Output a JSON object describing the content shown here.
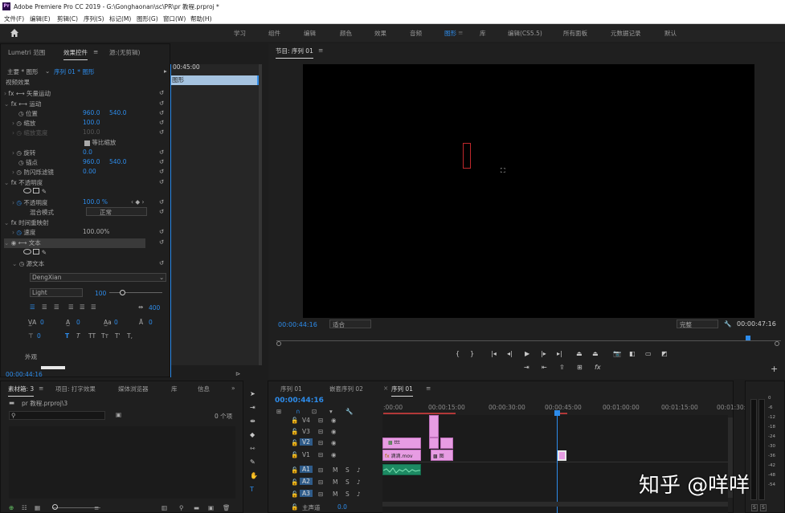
{
  "app": {
    "title": "Adobe Premiere Pro CC 2019 - G:\\Gonghaonan\\sc\\PR\\pr 教程.prproj *"
  },
  "menu": [
    "文件(F)",
    "编辑(E)",
    "剪辑(C)",
    "序列(S)",
    "标记(M)",
    "图形(G)",
    "窗口(W)",
    "帮助(H)"
  ],
  "workspaces": [
    "学习",
    "组件",
    "编辑",
    "颜色",
    "效果",
    "音频",
    "图形",
    "库",
    "编辑(CS5.5)",
    "所有面板",
    "元数据记录",
    "默认"
  ],
  "active_workspace": "图形",
  "effects_panel": {
    "tabs": [
      "Lumetri 范围",
      "效果控件",
      "源:(无剪辑)"
    ],
    "master": "主要 * 图形",
    "sequence": "序列 01 * 图形",
    "timecode_start": "00:45:00",
    "clip_label": "图形",
    "section_video": "视频效果",
    "rows": [
      {
        "label": "矢量运动"
      },
      {
        "label": "运动"
      },
      {
        "label": "位置",
        "v1": "960.0",
        "v2": "540.0"
      },
      {
        "label": "缩放",
        "v1": "100.0"
      },
      {
        "label": "缩放宽度",
        "v1": "100.0"
      },
      {
        "label": "等比缩放"
      },
      {
        "label": "旋转",
        "v1": "0.0"
      },
      {
        "label": "锚点",
        "v1": "960.0",
        "v2": "540.0"
      },
      {
        "label": "防闪烁滤镜",
        "v1": "0.00"
      },
      {
        "label": "不透明度"
      },
      {
        "label": "不透明度",
        "v1": "100.0 %"
      },
      {
        "label": "混合模式",
        "v1": "正常"
      },
      {
        "label": "时间重映射"
      },
      {
        "label": "速度",
        "v1": "100.00%"
      },
      {
        "label": "文本"
      },
      {
        "label": "源文本"
      }
    ],
    "font": "DengXian",
    "font_style": "Light",
    "font_size": "100",
    "tracking": "400",
    "zero_values": [
      "0",
      "0",
      "0",
      "0"
    ],
    "text_style_buttons": [
      "T",
      "T",
      "TT",
      "Tт",
      "T'",
      "T,"
    ],
    "appearance": "外观",
    "bottom_timecode": "00:00:44:16"
  },
  "program_monitor": {
    "title": "节目: 序列 01",
    "timecode_current": "00:00:44:16",
    "fit": "适合",
    "quality": "完整",
    "timecode_end": "00:00:47:16"
  },
  "project_panel": {
    "tabs": [
      "素材箱: 3",
      "项目: 打字效果",
      "媒体浏览器",
      "库",
      "信息"
    ],
    "path": "pr 教程.prproj\\3",
    "item_count": "0 个项"
  },
  "timeline": {
    "tabs": [
      "序列 01",
      "嵌套序列 02",
      "序列 01"
    ],
    "timecode": "00:00:44:16",
    "ruler": [
      ":00:00",
      "00:00:15:00",
      "00:00:30:00",
      "00:00:45:00",
      "00:01:00:00",
      "00:01:15:00",
      "00:01:30:00"
    ],
    "video_tracks": [
      "V4",
      "V3",
      "V2",
      "V1"
    ],
    "audio_tracks": [
      "A1",
      "A2",
      "A3"
    ],
    "master": "主声道",
    "master_value": "0.0",
    "clips": [
      {
        "label": "ttt",
        "track": "V2"
      },
      {
        "label": "滴滴.mov",
        "track": "V1"
      },
      {
        "label": "图",
        "track": "V1"
      }
    ]
  },
  "meters": {
    "scale": [
      "0",
      "-6",
      "-12",
      "-18",
      "-24",
      "-30",
      "-36",
      "-42",
      "-48",
      "-54"
    ],
    "solo": [
      "S",
      "S"
    ]
  },
  "watermark": "知乎 @咩咩",
  "colors": {
    "accent": "#2d8ceb",
    "clip_pink": "#e79ce3",
    "audio_green": "#1d8a63",
    "playhead": "#2d8ceb"
  }
}
